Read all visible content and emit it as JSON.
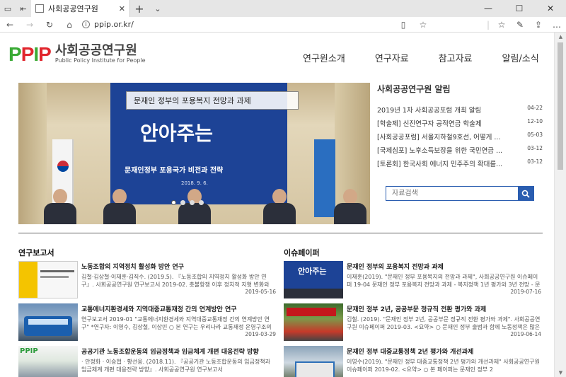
{
  "browser": {
    "tab_title": "사회공공연구원",
    "url": "ppip.or.kr/"
  },
  "site": {
    "logo_mark": "PPIP",
    "logo_ko": "사회공공연구원",
    "logo_en": "Public Policy Institute for People",
    "menu": [
      "연구원소개",
      "연구자료",
      "참고자료",
      "알림/소식"
    ]
  },
  "hero": {
    "caption": "문재인 정부의 포용복지 전망과 과제",
    "banner_big": "안아주는",
    "banner_sub": "문재인정부 포용국가 비전과 전략",
    "banner_date": "2018. 9. 6."
  },
  "notice": {
    "title": "사회공공연구원 알림",
    "items": [
      {
        "text": "2019년 1차 사회공공포럼 개최 알림",
        "date": "04-22"
      },
      {
        "text": "[학술제] 신진연구자 공적연금 학술제",
        "date": "12-10"
      },
      {
        "text": "[사회공공포럼] 서울지하철9호선, 어떻게 ...",
        "date": "05-03"
      },
      {
        "text": "[국제심포] 노후소득보장을 위한 국민연금 ...",
        "date": "03-12"
      },
      {
        "text": "[토론회] 한국사회 에너지 민주주의 확대를...",
        "date": "03-12"
      }
    ],
    "search_placeholder": "자료검색"
  },
  "reports": {
    "title": "연구보고서",
    "items": [
      {
        "title": "노동조합의 지역정치 활성화 방안 연구",
        "desc": "김철·김상철·이재훈·김직수. (2019.5). 『노동조합의 지역정치 활성화 방안 연구』. 사회공공연구원 연구보고서 2019-02. 촛불항쟁 이후 정치적 지형 변화와 지방분...",
        "date": "2019-05-16"
      },
      {
        "title": "교통에너지환경세와 지역대중교통재정 간의 연계방안 연구",
        "desc": "연구보고서 2019-01 \"교통에너지환경세와 지역대중교통재정 간의 연계방안 연구\" *연구자: 이영수, 김상철, 이상민 ○ 본 연구는 우리나라 교통재정 운영구조의 현황과 문제점을 분석하고 ...",
        "date": "2019-03-29"
      },
      {
        "title": "공공기관 노동조합운동의 임금정책과 임금체계 개편 대응전략 방향",
        "desc": "· 안정화 · 이승협 · 황선웅. (2018.11). 『공공기관 노동조합운동의 임금정책과 임금체계 개편 대응전략 방향』. 사회공공연구원 연구보고서",
        "date": ""
      }
    ]
  },
  "issues": {
    "title": "이슈페이퍼",
    "items": [
      {
        "title": "문재인 정부의 포용복지 전망과 과제",
        "desc": "이재훈(2019). \"문재인 정부 포용복지의 전망과 과제\", 사회공공연구원 이슈페이퍼 19-04 문재인 정부 포용복지 전망과 과제 - 복지정책 1년 평가와 3년 전망 - 문재인 정부가 표방하는 &...",
        "date": "2019-07-16"
      },
      {
        "title": "문재인 정부 2년, 공공부문 정규직 전환 평가와 과제",
        "desc": "김철. (2019). \"문재인 정부 2년, 공공부문 정규직 전환 평가와 과제\". 사회공공연구원 이슈페이퍼 2019-03. <요약> ○ 문재인 정부 출범과 함께 노동정책은 많은 변화와 전환을 이룰 것으로...",
        "date": "2019-06-14"
      },
      {
        "title": "문재인 정부 대중교통정책 2년 평가와 개선과제",
        "desc": "이영수(2019). \"문재인 정부 대중교통정책 2년 평가와 개선과제\" 사회공공연구원 이슈페이퍼 2019-02. <요약> ○ 본 페이퍼는 문재인 정부 2",
        "date": ""
      }
    ]
  },
  "colors": {
    "brand_green": "#3aaa35",
    "brand_red": "#e1262d",
    "accent_blue": "#2a5db0"
  }
}
